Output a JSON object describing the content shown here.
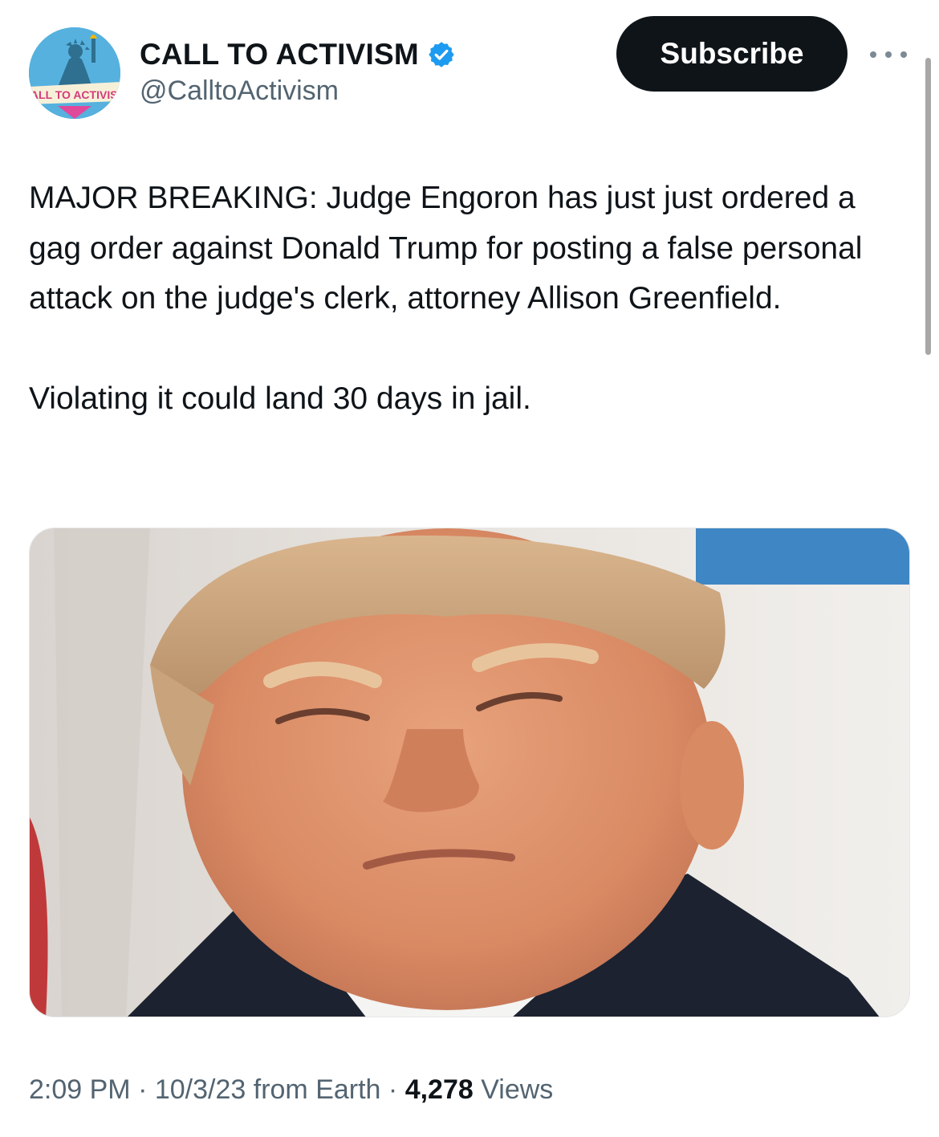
{
  "account": {
    "display_name": "CALL TO ACTIVISM",
    "handle": "@CalltoActivism",
    "avatar_label": "CALL TO ACTIVISM",
    "verified_color": "#1d9bf0"
  },
  "actions": {
    "subscribe_label": "Subscribe"
  },
  "tweet": {
    "text": "MAJOR BREAKING: Judge Engoron has just just ordered a gag order against Donald Trump for posting a false personal attack on the judge's clerk, attorney Allison Greenfield.\n\nViolating it could land 30 days in jail."
  },
  "meta": {
    "time": "2:09 PM",
    "separator": " · ",
    "date": "10/3/23",
    "source": " from Earth",
    "views_count": "4,278",
    "views_label": " Views"
  },
  "colors": {
    "text": "#0f1419",
    "secondary": "#536471",
    "button_bg": "#0f1419"
  }
}
